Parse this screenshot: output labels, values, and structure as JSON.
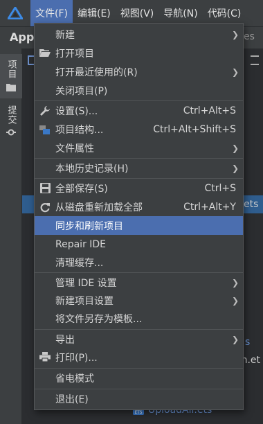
{
  "menubar": {
    "items": [
      "文件(F)",
      "编辑(E)",
      "视图(V)",
      "导航(N)",
      "代码(C)"
    ],
    "active_index": 0
  },
  "background": {
    "project_title": "Appl",
    "breadcrumb_suffix": "es",
    "tool_tabs": [
      "项目",
      "提交"
    ],
    "selected_row_suffix": "ets",
    "partial_texts": [
      "s",
      "on.et"
    ],
    "upload_file": "UploadAll.ets"
  },
  "file_menu": {
    "items": [
      {
        "label": "新建",
        "shortcut": "",
        "submenu": true,
        "icon": "",
        "separator_before": false
      },
      {
        "label": "打开项目",
        "shortcut": "",
        "submenu": false,
        "icon": "folder-open-icon",
        "separator_before": false
      },
      {
        "label": "打开最近使用的(R)",
        "shortcut": "",
        "submenu": true,
        "icon": "",
        "separator_before": false
      },
      {
        "label": "关闭项目(P)",
        "shortcut": "",
        "submenu": false,
        "icon": "",
        "separator_before": false
      },
      {
        "label": "设置(S)...",
        "shortcut": "Ctrl+Alt+S",
        "submenu": false,
        "icon": "wrench-icon",
        "separator_before": true
      },
      {
        "label": "项目结构...",
        "shortcut": "Ctrl+Alt+Shift+S",
        "submenu": false,
        "icon": "project-structure-icon",
        "separator_before": false
      },
      {
        "label": "文件属性",
        "shortcut": "",
        "submenu": true,
        "icon": "",
        "separator_before": false
      },
      {
        "label": "本地历史记录(H)",
        "shortcut": "",
        "submenu": true,
        "icon": "",
        "separator_before": true
      },
      {
        "label": "全部保存(S)",
        "shortcut": "Ctrl+S",
        "submenu": false,
        "icon": "save-icon",
        "separator_before": true
      },
      {
        "label": "从磁盘重新加载全部",
        "shortcut": "Ctrl+Alt+Y",
        "submenu": false,
        "icon": "reload-icon",
        "separator_before": false
      },
      {
        "label": "同步和刷新项目",
        "shortcut": "",
        "submenu": false,
        "icon": "",
        "separator_before": false,
        "highlighted": true
      },
      {
        "label": "Repair IDE",
        "shortcut": "",
        "submenu": false,
        "icon": "",
        "separator_before": false
      },
      {
        "label": "清理缓存...",
        "shortcut": "",
        "submenu": false,
        "icon": "",
        "separator_before": false
      },
      {
        "label": "管理 IDE 设置",
        "shortcut": "",
        "submenu": true,
        "icon": "",
        "separator_before": true
      },
      {
        "label": "新建项目设置",
        "shortcut": "",
        "submenu": true,
        "icon": "",
        "separator_before": false
      },
      {
        "label": "将文件另存为模板...",
        "shortcut": "",
        "submenu": false,
        "icon": "",
        "separator_before": false
      },
      {
        "label": "导出",
        "shortcut": "",
        "submenu": true,
        "icon": "",
        "separator_before": true
      },
      {
        "label": "打印(P)...",
        "shortcut": "",
        "submenu": false,
        "icon": "printer-icon",
        "separator_before": false
      },
      {
        "label": "省电模式",
        "shortcut": "",
        "submenu": false,
        "icon": "",
        "separator_before": true
      },
      {
        "label": "退出(E)",
        "shortcut": "",
        "submenu": false,
        "icon": "",
        "separator_before": true
      }
    ]
  },
  "colors": {
    "menu_bg": "#3c3f41",
    "highlight": "#4b6eaf",
    "selection_row": "#2f5d8e",
    "link_blue": "#6c96d8"
  }
}
